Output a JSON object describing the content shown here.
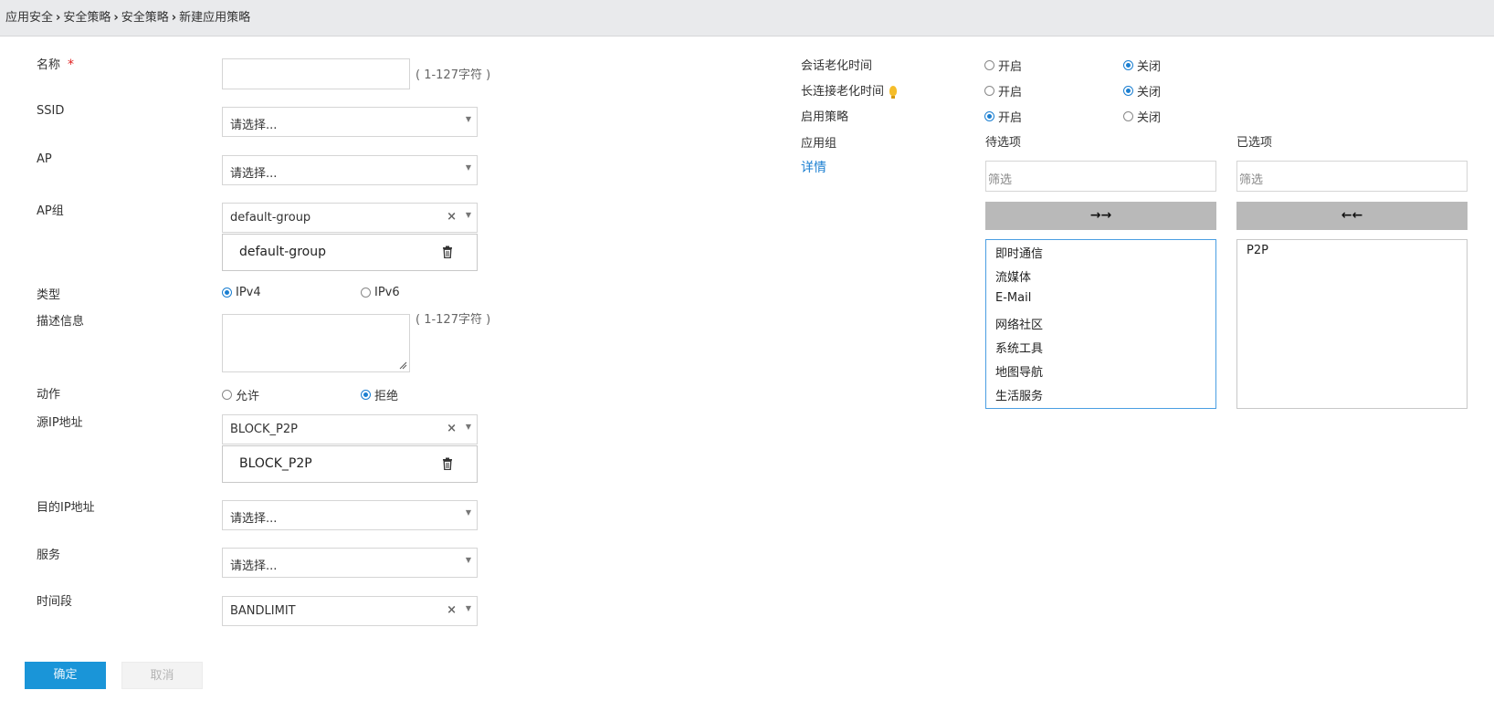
{
  "breadcrumb": [
    "应用安全",
    "安全策略",
    "安全策略",
    "新建应用策略"
  ],
  "form": {
    "name": {
      "label": "名称",
      "required_mark": "*",
      "value": "",
      "hint": "( 1-127字符 )"
    },
    "ssid": {
      "label": "SSID",
      "placeholder": "请选择..."
    },
    "ap": {
      "label": "AP",
      "placeholder": "请选择..."
    },
    "ap_group": {
      "label": "AP组",
      "value": "default-group",
      "tag": "default-group"
    },
    "type": {
      "label": "类型",
      "options": [
        "IPv4",
        "IPv6"
      ],
      "selected": "IPv4"
    },
    "description": {
      "label": "描述信息",
      "value": "",
      "hint": "( 1-127字符 )"
    },
    "action": {
      "label": "动作",
      "options": [
        "允许",
        "拒绝"
      ],
      "selected": "拒绝"
    },
    "src_ip": {
      "label": "源IP地址",
      "value": "BLOCK_P2P",
      "tag": "BLOCK_P2P"
    },
    "dst_ip": {
      "label": "目的IP地址",
      "placeholder": "请选择..."
    },
    "service": {
      "label": "服务",
      "placeholder": "请选择..."
    },
    "time_range": {
      "label": "时间段",
      "value": "BANDLIMIT"
    }
  },
  "right": {
    "session_aging": {
      "label": "会话老化时间",
      "options": [
        "开启",
        "关闭"
      ],
      "selected": "关闭"
    },
    "long_conn_aging": {
      "label": "长连接老化时间",
      "options": [
        "开启",
        "关闭"
      ],
      "selected": "关闭",
      "icon": "lightbulb-icon"
    },
    "enable_policy": {
      "label": "启用策略",
      "options": [
        "开启",
        "关闭"
      ],
      "selected": "开启"
    },
    "app_group": {
      "label": "应用组",
      "detail_link": "详情",
      "available_header": "待选项",
      "selected_header": "已选项",
      "filter_placeholder": "筛选",
      "move_right": "→→",
      "move_left": "←←",
      "available": [
        "即时通信",
        "流媒体",
        "E-Mail",
        "网络社区",
        "系统工具",
        "地图导航",
        "生活服务"
      ],
      "selected": [
        "P2P"
      ]
    }
  },
  "buttons": {
    "confirm": "确定",
    "cancel": "取消"
  },
  "colors": {
    "accent": "#1b7fd1",
    "confirm_bg": "#1a95d8",
    "required": "#e02020",
    "bulb": "#f5bd2a"
  }
}
